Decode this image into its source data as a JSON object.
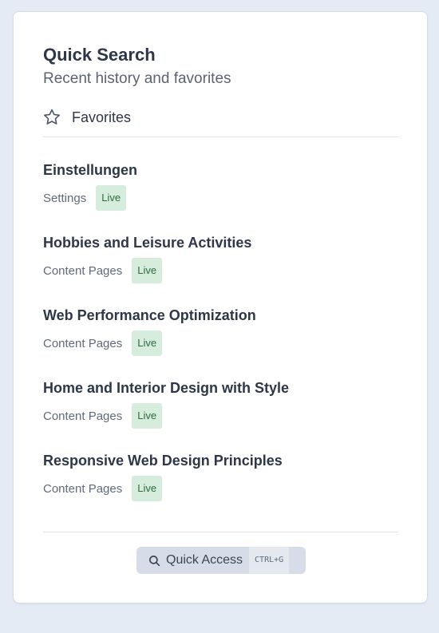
{
  "panel": {
    "title": "Quick Search",
    "subtitle": "Recent history and favorites"
  },
  "favorites": {
    "icon": "star-icon",
    "label": "Favorites"
  },
  "items": [
    {
      "title": "Einstellungen",
      "category": "Settings",
      "status": "Live"
    },
    {
      "title": "Hobbies and Leisure Activities",
      "category": "Content Pages",
      "status": "Live"
    },
    {
      "title": "Web Performance Optimization",
      "category": "Content Pages",
      "status": "Live"
    },
    {
      "title": "Home and Interior Design with Style",
      "category": "Content Pages",
      "status": "Live"
    },
    {
      "title": "Responsive Web Design Principles",
      "category": "Content Pages",
      "status": "Live"
    }
  ],
  "quick_access": {
    "icon": "search-icon",
    "label": "Quick Access",
    "shortcut": "CTRL+G"
  },
  "colors": {
    "background": "#e4ebf4",
    "card": "#ffffff",
    "text_primary": "#2d3748",
    "text_secondary": "#5f6b7a",
    "badge_bg": "#d6ecdc",
    "badge_text": "#2e6b40",
    "button_bg": "#d6dde8"
  }
}
